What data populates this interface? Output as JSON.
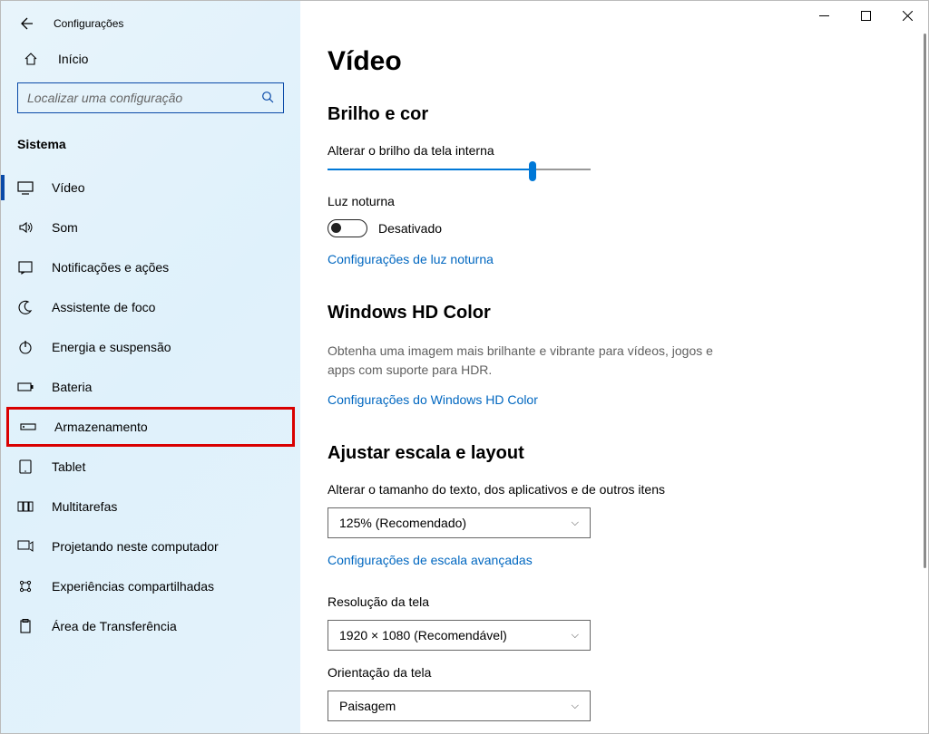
{
  "window_title": "Configurações",
  "home_label": "Início",
  "search_placeholder": "Localizar uma configuração",
  "section_heading": "Sistema",
  "nav": [
    {
      "label": "Vídeo",
      "icon": "display-icon",
      "active": true
    },
    {
      "label": "Som",
      "icon": "sound-icon"
    },
    {
      "label": "Notificações e ações",
      "icon": "notifications-icon"
    },
    {
      "label": "Assistente de foco",
      "icon": "moon-icon"
    },
    {
      "label": "Energia e suspensão",
      "icon": "power-icon"
    },
    {
      "label": "Bateria",
      "icon": "battery-icon"
    },
    {
      "label": "Armazenamento",
      "icon": "storage-icon",
      "highlighted": true
    },
    {
      "label": "Tablet",
      "icon": "tablet-icon"
    },
    {
      "label": "Multitarefas",
      "icon": "multitask-icon"
    },
    {
      "label": "Projetando neste computador",
      "icon": "project-icon"
    },
    {
      "label": "Experiências compartilhadas",
      "icon": "shared-icon"
    },
    {
      "label": "Área de Transferência",
      "icon": "clipboard-icon"
    }
  ],
  "page": {
    "title": "Vídeo",
    "brightness": {
      "heading": "Brilho e cor",
      "slider_label": "Alterar o brilho da tela interna",
      "slider_percent": 78,
      "night_light_label": "Luz noturna",
      "night_light_state": "Desativado",
      "night_light_link": "Configurações de luz noturna"
    },
    "hdcolor": {
      "heading": "Windows HD Color",
      "description": "Obtenha uma imagem mais brilhante e vibrante para vídeos, jogos e apps com suporte para HDR.",
      "link": "Configurações do Windows HD Color"
    },
    "scale": {
      "heading": "Ajustar escala e layout",
      "text_size_label": "Alterar o tamanho do texto, dos aplicativos e de outros itens",
      "text_size_value": "125% (Recomendado)",
      "advanced_link": "Configurações de escala avançadas",
      "resolution_label": "Resolução da tela",
      "resolution_value": "1920 × 1080 (Recomendável)",
      "orientation_label": "Orientação da tela",
      "orientation_value": "Paisagem"
    }
  }
}
